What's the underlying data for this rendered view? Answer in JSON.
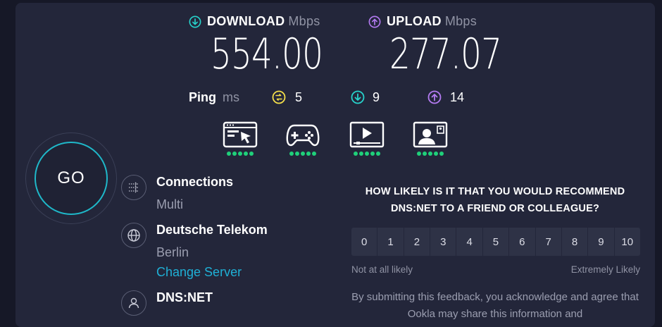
{
  "download": {
    "label": "DOWNLOAD",
    "unit": "Mbps",
    "value": "554.00"
  },
  "upload": {
    "label": "UPLOAD",
    "unit": "Mbps",
    "value": "277.07"
  },
  "ping": {
    "label": "Ping",
    "unit": "ms",
    "idle": "5",
    "download": "9",
    "upload": "14"
  },
  "use_cases": [
    {
      "icon": "web-browsing-icon",
      "rating": 5
    },
    {
      "icon": "gaming-icon",
      "rating": 5
    },
    {
      "icon": "video-streaming-icon",
      "rating": 5
    },
    {
      "icon": "video-chat-icon",
      "rating": 5
    }
  ],
  "go_label": "GO",
  "connections": {
    "title": "Connections",
    "value": "Multi"
  },
  "provider": {
    "title": "Deutsche Telekom",
    "location": "Berlin",
    "change_label": "Change Server"
  },
  "isp": {
    "title": "DNS:NET"
  },
  "survey": {
    "question": "HOW LIKELY IS IT THAT YOU WOULD RECOMMEND DNS:NET TO A FRIEND OR COLLEAGUE?",
    "scale": [
      "0",
      "1",
      "2",
      "3",
      "4",
      "5",
      "6",
      "7",
      "8",
      "9",
      "10"
    ],
    "low_label": "Not at all likely",
    "high_label": "Extremely Likely",
    "consent": "By submitting this feedback, you acknowledge and agree that Ookla may share this information and"
  },
  "colors": {
    "download_accent": "#27d3cc",
    "upload_accent": "#b47bf2",
    "ping_accent": "#f5e04a",
    "rating_dot": "#1fd07a",
    "link": "#1fb0d6"
  }
}
